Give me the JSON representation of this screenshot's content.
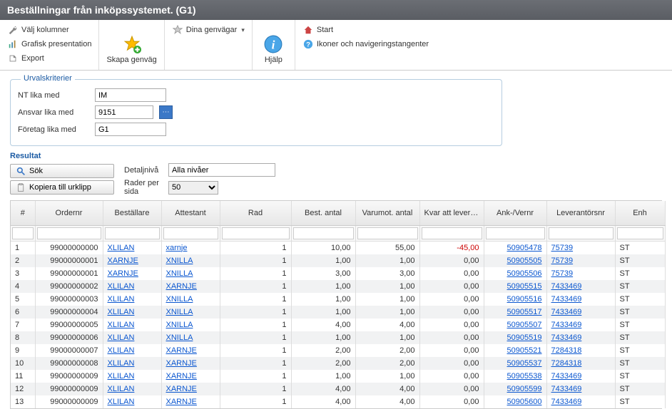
{
  "title": "Beställningar från inköpssystemet. (G1)",
  "toolbar": {
    "valj_kolumner": "Välj kolumner",
    "grafisk": "Grafisk presentation",
    "export": "Export",
    "skapa_genvag": "Skapa genväg",
    "dina_genvagar": "Dina genvägar",
    "hjalp": "Hjälp",
    "start": "Start",
    "ikoner": "Ikoner och navigeringstangenter"
  },
  "criteria": {
    "legend": "Urvalskriterier",
    "nt_label": "NT lika med",
    "nt_value": "IM",
    "ansvar_label": "Ansvar lika med",
    "ansvar_value": "9151",
    "foretag_label": "Företag lika med",
    "foretag_value": "G1"
  },
  "result": {
    "title": "Resultat",
    "sok": "Sök",
    "kopiera": "Kopiera till urklipp",
    "detaljniva_label": "Detaljnivå",
    "detaljniva_value": "Alla nivåer",
    "rader_label": "Rader per sida",
    "rader_value": "50"
  },
  "columns": [
    "#",
    "Ordernr",
    "Beställare",
    "Attestant",
    "Rad",
    "Best. antal",
    "Varumot. antal",
    "Kvar att levereras",
    "Ank-/Vernr",
    "Leverantörsnr",
    "Enh"
  ],
  "rows": [
    {
      "n": "1",
      "order": "99000000000",
      "best": "XLILAN",
      "att": "xarnje",
      "rad": "1",
      "ba": "10,00",
      "va": "55,00",
      "kvar": "-45,00",
      "ank": "50905478",
      "lev": "75739",
      "enh": "ST"
    },
    {
      "n": "2",
      "order": "99000000001",
      "best": "XARNJE",
      "att": "XNILLA",
      "rad": "1",
      "ba": "1,00",
      "va": "1,00",
      "kvar": "0,00",
      "ank": "50905505",
      "lev": "75739",
      "enh": "ST"
    },
    {
      "n": "3",
      "order": "99000000001",
      "best": "XARNJE",
      "att": "XNILLA",
      "rad": "1",
      "ba": "3,00",
      "va": "3,00",
      "kvar": "0,00",
      "ank": "50905506",
      "lev": "75739",
      "enh": "ST"
    },
    {
      "n": "4",
      "order": "99000000002",
      "best": "XLILAN",
      "att": "XARNJE",
      "rad": "1",
      "ba": "1,00",
      "va": "1,00",
      "kvar": "0,00",
      "ank": "50905515",
      "lev": "7433469",
      "enh": "ST"
    },
    {
      "n": "5",
      "order": "99000000003",
      "best": "XLILAN",
      "att": "XNILLA",
      "rad": "1",
      "ba": "1,00",
      "va": "1,00",
      "kvar": "0,00",
      "ank": "50905516",
      "lev": "7433469",
      "enh": "ST"
    },
    {
      "n": "6",
      "order": "99000000004",
      "best": "XLILAN",
      "att": "XNILLA",
      "rad": "1",
      "ba": "1,00",
      "va": "1,00",
      "kvar": "0,00",
      "ank": "50905517",
      "lev": "7433469",
      "enh": "ST"
    },
    {
      "n": "7",
      "order": "99000000005",
      "best": "XLILAN",
      "att": "XNILLA",
      "rad": "1",
      "ba": "4,00",
      "va": "4,00",
      "kvar": "0,00",
      "ank": "50905507",
      "lev": "7433469",
      "enh": "ST"
    },
    {
      "n": "8",
      "order": "99000000006",
      "best": "XLILAN",
      "att": "XNILLA",
      "rad": "1",
      "ba": "1,00",
      "va": "1,00",
      "kvar": "0,00",
      "ank": "50905519",
      "lev": "7433469",
      "enh": "ST"
    },
    {
      "n": "9",
      "order": "99000000007",
      "best": "XLILAN",
      "att": "XARNJE",
      "rad": "1",
      "ba": "2,00",
      "va": "2,00",
      "kvar": "0,00",
      "ank": "50905521",
      "lev": "7284318",
      "enh": "ST"
    },
    {
      "n": "10",
      "order": "99000000008",
      "best": "XLILAN",
      "att": "XARNJE",
      "rad": "1",
      "ba": "2,00",
      "va": "2,00",
      "kvar": "0,00",
      "ank": "50905537",
      "lev": "7284318",
      "enh": "ST"
    },
    {
      "n": "11",
      "order": "99000000009",
      "best": "XLILAN",
      "att": "XARNJE",
      "rad": "1",
      "ba": "1,00",
      "va": "1,00",
      "kvar": "0,00",
      "ank": "50905538",
      "lev": "7433469",
      "enh": "ST"
    },
    {
      "n": "12",
      "order": "99000000009",
      "best": "XLILAN",
      "att": "XARNJE",
      "rad": "1",
      "ba": "4,00",
      "va": "4,00",
      "kvar": "0,00",
      "ank": "50905599",
      "lev": "7433469",
      "enh": "ST"
    },
    {
      "n": "13",
      "order": "99000000009",
      "best": "XLILAN",
      "att": "XARNJE",
      "rad": "1",
      "ba": "4,00",
      "va": "4,00",
      "kvar": "0,00",
      "ank": "50905600",
      "lev": "7433469",
      "enh": "ST"
    }
  ]
}
